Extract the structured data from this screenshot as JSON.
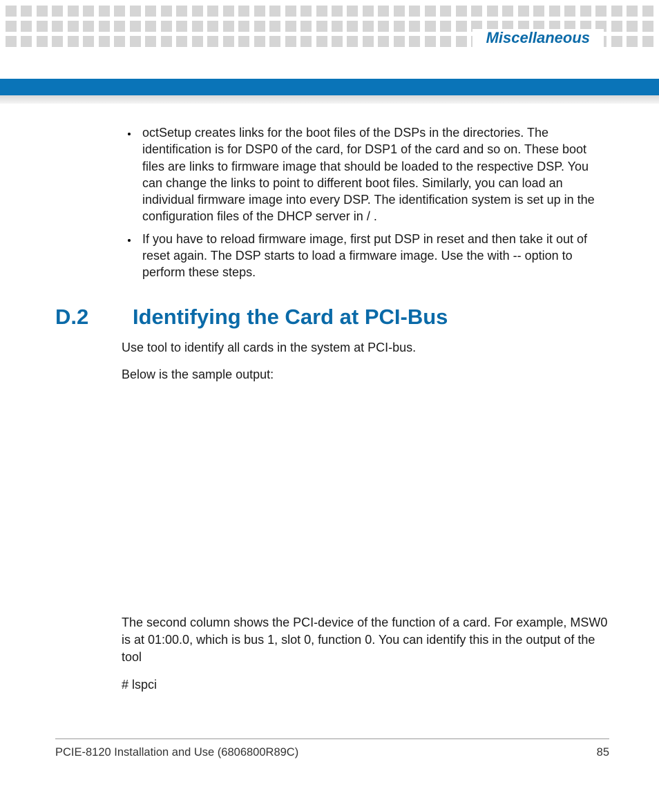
{
  "header": {
    "category": "Miscellaneous"
  },
  "bullets": [
    "octSetup creates links for the boot files of the DSPs in the               directories. The identification is                       for DSP0 of the card,                       for DSP1 of the card and so on. These boot files are links to firmware image that should be loaded to the respective DSP. You can change the links to point to different boot files. Similarly, you can load an individual firmware image into every DSP. The identification system is set up in the configuration files of the DHCP server                                         in /                                                    .",
    "If you have to reload firmware image, first put DSP in reset and then take it out of reset again. The DSP starts to load a firmware image. Use the                               with --                                        option to perform these steps."
  ],
  "section": {
    "number": "D.2",
    "title": "Identifying the Card at PCI-Bus",
    "intro": "Use                                       tool to identify all cards in the system at PCI-bus.",
    "sample_label": " Below is the sample output:",
    "explain": "The second column shows the PCI-device of the function of a card. For example, MSW0 is at 01:00.0, which is bus 1, slot 0, function 0. You can identify this in the output of the tool",
    "cmd": "# lspci"
  },
  "footer": {
    "doc": "PCIE-8120 Installation and Use (6806800R89C)",
    "page": "85"
  }
}
